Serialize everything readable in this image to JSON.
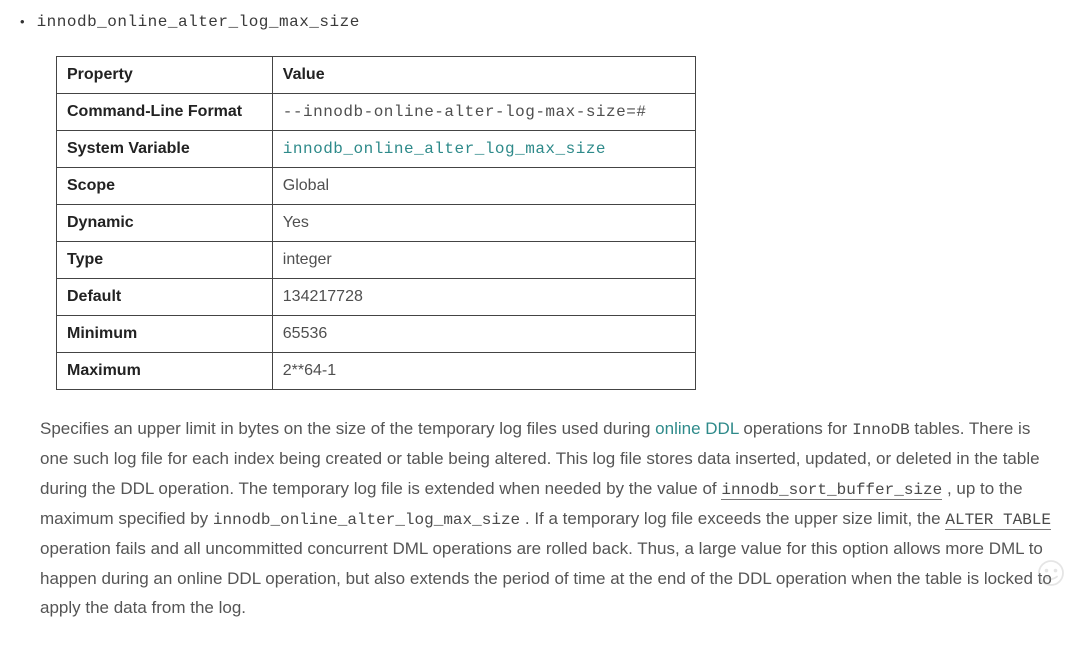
{
  "bullet": {
    "glyph": "•",
    "variable": "innodb_online_alter_log_max_size"
  },
  "table": {
    "headers": {
      "property": "Property",
      "value": "Value"
    },
    "rows": [
      {
        "property": "Command-Line Format",
        "value": "--innodb-online-alter-log-max-size=#",
        "code": true,
        "link": false
      },
      {
        "property": "System Variable",
        "value": "innodb_online_alter_log_max_size",
        "code": true,
        "link": true
      },
      {
        "property": "Scope",
        "value": "Global",
        "code": false,
        "link": false
      },
      {
        "property": "Dynamic",
        "value": "Yes",
        "code": false,
        "link": false
      },
      {
        "property": "Type",
        "value": "integer",
        "code": false,
        "link": false
      },
      {
        "property": "Default",
        "value": "134217728",
        "code": false,
        "link": false
      },
      {
        "property": "Minimum",
        "value": "65536",
        "code": false,
        "link": false
      },
      {
        "property": "Maximum",
        "value": "2**64-1",
        "code": false,
        "link": false
      }
    ]
  },
  "desc": {
    "t0": "Specifies an upper limit in bytes on the size of the temporary log files used during ",
    "link_online_ddl": "online DDL",
    "t1": " operations for ",
    "code_innodb": "InnoDB",
    "t2": " tables. There is one such log file for each index being created or table being altered. This log file stores data inserted, updated, or deleted in the table during the DDL operation. The temporary log file is extended when needed by the value of ",
    "code_sort_buf": "innodb_sort_buffer_size",
    "t3": ", up to the maximum specified by ",
    "code_max_size": "innodb_online_alter_log_max_size",
    "t4": ". If a temporary log file exceeds the upper size limit, the ",
    "code_alter_table": "ALTER TABLE",
    "t5": " operation fails and all uncommitted concurrent DML operations are rolled back. Thus, a large value for this option allows more DML to happen during an online DDL operation, but also extends the period of time at the end of the DDL operation when the table is locked to apply the data from the log."
  }
}
